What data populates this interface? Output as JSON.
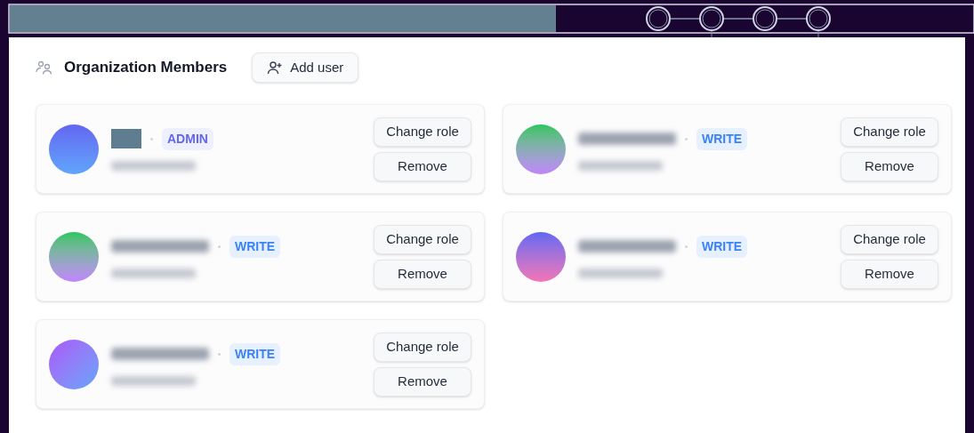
{
  "header": {
    "title": "Organization Members",
    "add_button": "Add user"
  },
  "members": [
    {
      "kind": "admin",
      "role": "ADMIN",
      "name_masked": true,
      "actions": [
        "Change role",
        "Remove"
      ]
    },
    {
      "kind": "write",
      "role": "WRITE",
      "name_masked": false,
      "actions": [
        "Change role",
        "Remove"
      ]
    },
    {
      "kind": "write",
      "role": "WRITE",
      "name_masked": false,
      "actions": [
        "Change role",
        "Remove"
      ]
    },
    {
      "kind": "write",
      "role": "WRITE",
      "name_masked": false,
      "actions": [
        "Change role",
        "Remove"
      ]
    },
    {
      "kind": "write",
      "role": "WRITE",
      "name_masked": false,
      "actions": [
        "Change role",
        "Remove"
      ]
    }
  ]
}
